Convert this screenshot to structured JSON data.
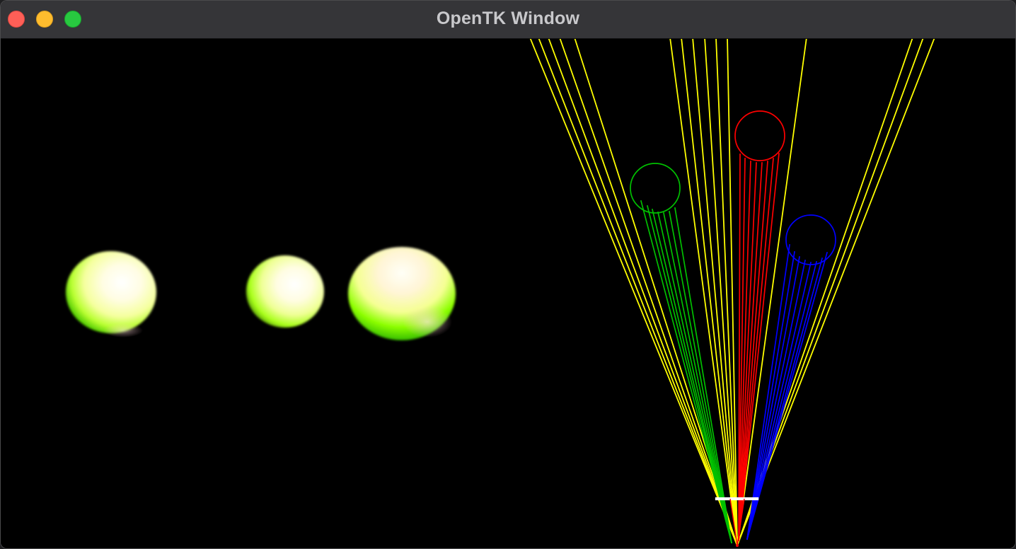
{
  "window": {
    "title": "OpenTK Window"
  },
  "controls": {
    "close": "close",
    "minimize": "minimize",
    "zoom": "zoom"
  },
  "scene": {
    "background": "#000000",
    "spheres": [
      {
        "name": "sphere-left",
        "highlight": "#fffde8",
        "shade": "#7be000"
      },
      {
        "name": "sphere-middle",
        "highlight": "#fffde8",
        "shade": "#7be000"
      },
      {
        "name": "sphere-right",
        "highlight": "#fffde8",
        "shade": "#20c000"
      }
    ],
    "ray_colors": {
      "yellow": "#ffff00",
      "green": "#00c000",
      "red": "#ff0000",
      "blue": "#0000ff",
      "white": "#ffffff"
    }
  }
}
